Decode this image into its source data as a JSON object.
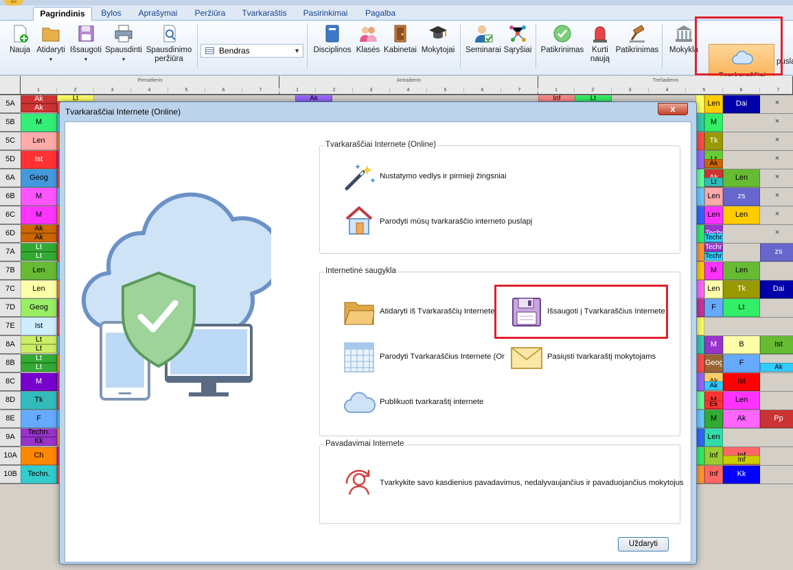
{
  "tabs": [
    "Pagrindinis",
    "Bylos",
    "Aprašymai",
    "Peržiūra",
    "Tvarkaraštis",
    "Pasirinkimai",
    "Pagalba"
  ],
  "ribbon": {
    "file_buttons": [
      "Nauja",
      "Atidaryti",
      "Išsaugoti",
      "Spausdinti",
      "Spausdinimo peržiūra"
    ],
    "view_combo": "Bendras",
    "data_buttons": [
      "Disciplinos",
      "Klasės",
      "Kabinetai",
      "Mokytojai"
    ],
    "rel_buttons": [
      "Seminarai",
      "Sąryšiai"
    ],
    "check_buttons": [
      "Patikrinimas",
      "Kurti naują",
      "Patikrinimas"
    ],
    "school_button": "Mokykla",
    "online_button": "Tvarkaraščiai Internete (Online)",
    "cut_text": "pusla"
  },
  "grid": {
    "days": [
      "Pirmadienis",
      "Antradienis",
      "Trečiadienis"
    ],
    "periods": [
      "1",
      "2",
      "3",
      "4",
      "5",
      "6",
      "7"
    ],
    "classes": [
      "5A",
      "5B",
      "5C",
      "5D",
      "6A",
      "6B",
      "6C",
      "6D",
      "7A",
      "7B",
      "7C",
      "7D",
      "7E",
      "8A",
      "8B",
      "8C",
      "8D",
      "8E",
      "9A",
      "10A",
      "10B"
    ],
    "first_col": [
      [
        "Ak",
        "Ak"
      ],
      [
        "M"
      ],
      [
        "Len"
      ],
      [
        "Ist"
      ],
      [
        "Geog"
      ],
      [
        "M"
      ],
      [
        "M"
      ],
      [
        "Ak",
        "Ak"
      ],
      [
        "Lt",
        "Lt"
      ],
      [
        "Len"
      ],
      [
        "Len"
      ],
      [
        "Geog"
      ],
      [
        "Ist"
      ],
      [
        "Lt",
        "Lt"
      ],
      [
        "Lt",
        "Lt"
      ],
      [
        "M"
      ],
      [
        "Tk"
      ],
      [
        "F"
      ],
      [
        "Techn.",
        "Kk"
      ],
      [
        "Ch"
      ],
      [
        "Techn."
      ]
    ],
    "top_row_cells": [
      "Lt",
      "Ak",
      "Inf",
      "Lt"
    ],
    "right_cells": [
      "Len",
      "Dai",
      "M",
      "Tk",
      "Lt",
      "Ak",
      "Ak",
      "Lt",
      "Len",
      "Len",
      "zs",
      "Len",
      "Len",
      "Techn.",
      "Techn.",
      "Techn.",
      "Techn.",
      "zs",
      "M",
      "Len",
      "Len",
      "Tk",
      "Dai",
      "Lt",
      "F",
      "M",
      "B",
      "Ist",
      "Geog",
      "F",
      "Ak",
      "Ak",
      "Ak",
      "Pp",
      "Ist",
      "M",
      "Len",
      "M",
      "Ak",
      "Ek",
      "Len",
      "Inf",
      "Inf",
      "Inf",
      "Inf",
      "Kk"
    ],
    "x_mark": "×"
  },
  "dialog": {
    "title": "Tvarkaraščiai Internete (Online)",
    "close_x": "x",
    "section1": {
      "title": "Tvarkaraščiai Internete (Online)",
      "items": [
        "Nustatymo vedlys ir pirmieji žingsniai",
        "Parodyti mūsų tvarkaraščio interneto puslapį"
      ]
    },
    "section2": {
      "title": "Internetinė saugykla",
      "items": [
        "Atidaryti iš Tvarkaraščių Internete",
        "Išsaugoti į Tvarkaraščius Internete",
        "Parodyti Tvarkaraščius Internete (Or",
        "Pasiųsti tvarkaraštį mokytojams",
        "Publikuoti tvarkaraštį internete"
      ]
    },
    "section3": {
      "title": "Pavadavimai Internete",
      "items": [
        "Tvarkykite savo kasdienius pavadavimus, nedalyvaujančius ir pavaduojančius mokytojus"
      ]
    },
    "close_button": "Uždaryti"
  }
}
